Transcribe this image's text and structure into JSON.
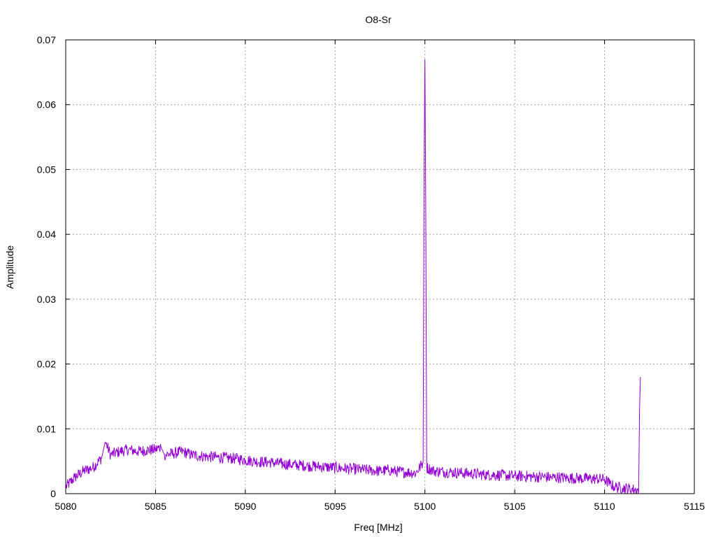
{
  "chart_data": {
    "type": "line",
    "title": "O8-Sr",
    "xlabel": "Freq [MHz]",
    "ylabel": "Amplitude",
    "xlim": [
      5080,
      5115
    ],
    "ylim": [
      0,
      0.07
    ],
    "xticks": [
      5080,
      5085,
      5090,
      5095,
      5100,
      5105,
      5110,
      5115
    ],
    "xtick_labels": [
      "5080",
      "5085",
      "5090",
      "5095",
      "5100",
      "5105",
      "5110",
      "5115"
    ],
    "yticks": [
      0,
      0.01,
      0.02,
      0.03,
      0.04,
      0.05,
      0.06,
      0.07
    ],
    "ytick_labels": [
      "0",
      "0.01",
      "0.02",
      "0.03",
      "0.04",
      "0.05",
      "0.06",
      "0.07"
    ],
    "grid": true,
    "legend": "none",
    "series": [
      {
        "color": "#9400d3",
        "x": [
          5080,
          5080.5,
          5081,
          5081.5,
          5082,
          5082.2,
          5082.5,
          5083,
          5083.5,
          5084,
          5084.5,
          5085,
          5085.3,
          5085.5,
          5086,
          5086.5,
          5087,
          5087.5,
          5088,
          5088.5,
          5089,
          5089.5,
          5090,
          5090.5,
          5091,
          5091.5,
          5092,
          5092.5,
          5093,
          5093.5,
          5094,
          5094.5,
          5095,
          5095.5,
          5096,
          5096.5,
          5097,
          5097.5,
          5098,
          5098.5,
          5099,
          5099.5,
          5099.9,
          5099.95,
          5100.0,
          5100.05,
          5100.1,
          5100.5,
          5101,
          5101.5,
          5102,
          5102.5,
          5103,
          5103.5,
          5104,
          5104.5,
          5105,
          5105.5,
          5106,
          5106.5,
          5107,
          5107.5,
          5108,
          5108.5,
          5109,
          5109.5,
          5110,
          5110.3,
          5110.6,
          5111,
          5111.5,
          5111.9,
          5111.95,
          5112.0
        ],
        "y": [
          0.001,
          0.0025,
          0.0035,
          0.004,
          0.0055,
          0.008,
          0.006,
          0.0065,
          0.0068,
          0.0065,
          0.0067,
          0.0068,
          0.0072,
          0.006,
          0.0062,
          0.0065,
          0.006,
          0.0058,
          0.0057,
          0.0056,
          0.0055,
          0.0054,
          0.0052,
          0.005,
          0.0049,
          0.0048,
          0.0046,
          0.0045,
          0.0044,
          0.0043,
          0.0042,
          0.0041,
          0.004,
          0.0039,
          0.0038,
          0.0037,
          0.0036,
          0.0035,
          0.0036,
          0.0034,
          0.0033,
          0.0032,
          0.0048,
          0.048,
          0.067,
          0.042,
          0.004,
          0.0035,
          0.0034,
          0.0033,
          0.0032,
          0.0031,
          0.003,
          0.0029,
          0.0029,
          0.0028,
          0.0027,
          0.0027,
          0.0026,
          0.0026,
          0.0025,
          0.0025,
          0.0024,
          0.0024,
          0.0023,
          0.0023,
          0.0022,
          0.0015,
          0.001,
          0.0009,
          0.0007,
          0.0005,
          0.013,
          0.018
        ]
      }
    ]
  }
}
